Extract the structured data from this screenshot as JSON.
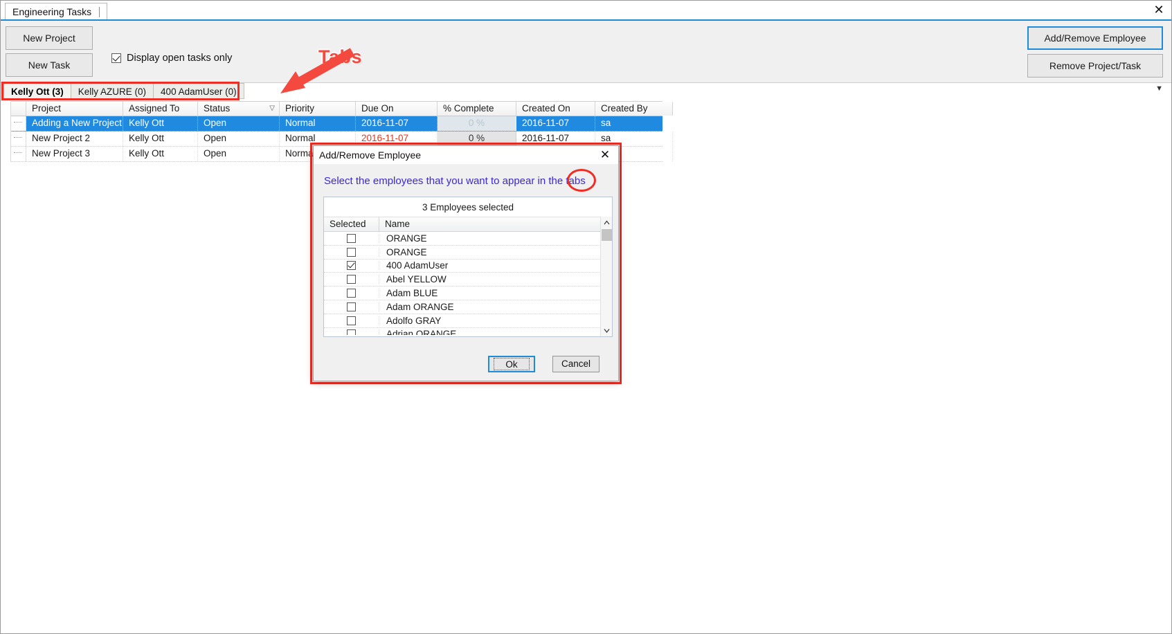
{
  "window": {
    "doc_tab": "Engineering Tasks",
    "close_icon": "close-icon"
  },
  "toolbar": {
    "new_project": "New Project",
    "new_task": "New Task",
    "display_open_tasks_label": "Display open tasks only",
    "display_open_tasks_checked": true,
    "add_remove_employee": "Add/Remove Employee",
    "remove_project_task": "Remove Project/Task",
    "overflow_caret": "▼"
  },
  "annotations": {
    "tabs_label": "Tabs",
    "highlight_color": "#ee2d24"
  },
  "employee_tabs": [
    {
      "label": "Kelly Ott (3)",
      "active": true
    },
    {
      "label": "Kelly AZURE (0)",
      "active": false
    },
    {
      "label": "400 AdamUser (0)",
      "active": false
    }
  ],
  "grid": {
    "columns": [
      {
        "label": "Project",
        "sort": ""
      },
      {
        "label": "Assigned To",
        "sort": ""
      },
      {
        "label": "Status",
        "sort": "▽"
      },
      {
        "label": "Priority",
        "sort": ""
      },
      {
        "label": "Due On",
        "sort": ""
      },
      {
        "label": "% Complete",
        "sort": ""
      },
      {
        "label": "Created On",
        "sort": ""
      },
      {
        "label": "Created By",
        "sort": ""
      }
    ],
    "rows": [
      {
        "selected": true,
        "project": "Adding a New Project",
        "assigned_to": "Kelly Ott",
        "status": "Open",
        "priority": "Normal",
        "due_on": "2016-11-07",
        "due_overdue": false,
        "pct_complete": "0 %",
        "created_on": "2016-11-07",
        "created_by": "sa"
      },
      {
        "selected": false,
        "project": "New Project 2",
        "assigned_to": "Kelly Ott",
        "status": "Open",
        "priority": "Normal",
        "due_on": "2016-11-07",
        "due_overdue": true,
        "pct_complete": "0 %",
        "created_on": "2016-11-07",
        "created_by": "sa"
      },
      {
        "selected": false,
        "project": "New Project 3",
        "assigned_to": "Kelly Ott",
        "status": "Open",
        "priority": "Normal",
        "due_on": "",
        "due_overdue": false,
        "pct_complete": "",
        "created_on": "",
        "created_by": ""
      }
    ]
  },
  "dialog": {
    "title": "Add/Remove Employee",
    "close_icon": "close-icon",
    "instruction": "Select the employees that you want to appear in the tabs",
    "selected_count_text": "3 Employees selected",
    "columns": [
      {
        "label": "Selected",
        "sort": ""
      },
      {
        "label": "Name",
        "sort": "⁄"
      }
    ],
    "employees": [
      {
        "name": "ORANGE",
        "checked": false
      },
      {
        "name": "ORANGE",
        "checked": false
      },
      {
        "name": "400 AdamUser",
        "checked": true
      },
      {
        "name": "Abel YELLOW",
        "checked": false
      },
      {
        "name": "Adam BLUE",
        "checked": false
      },
      {
        "name": "Adam ORANGE",
        "checked": false
      },
      {
        "name": "Adolfo GRAY",
        "checked": false
      },
      {
        "name": "Adrian ORANGE",
        "checked": false
      },
      {
        "name": "",
        "checked": false
      }
    ],
    "scrollbar": {
      "up": "⌃",
      "down": "⌄"
    },
    "ok": "Ok",
    "cancel": "Cancel"
  }
}
